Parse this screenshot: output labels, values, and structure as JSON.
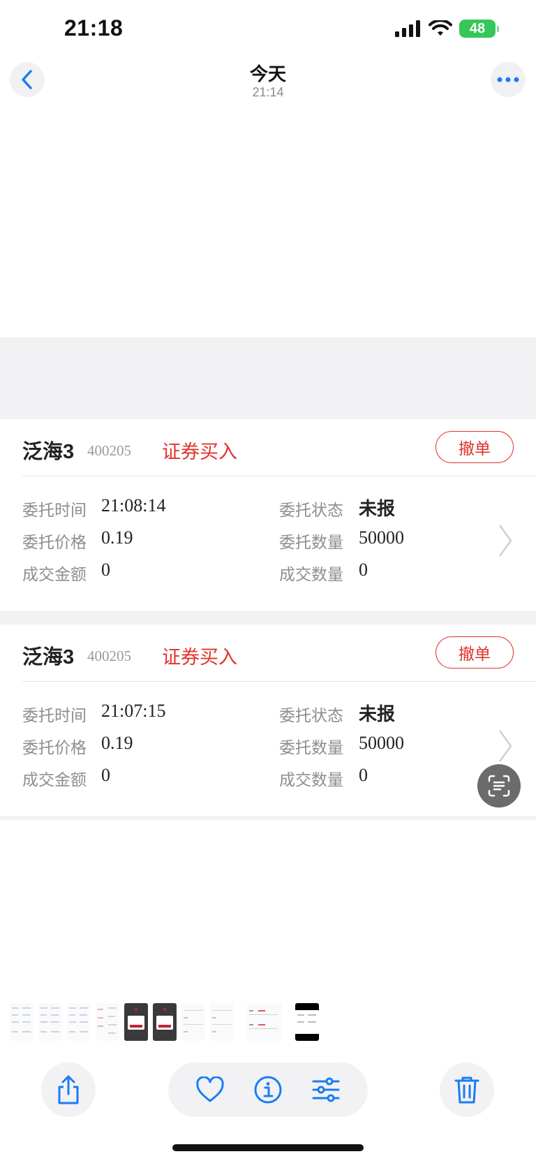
{
  "status_bar": {
    "time": "21:18",
    "battery": "48"
  },
  "nav": {
    "title": "今天",
    "subtitle": "21:14"
  },
  "orders": [
    {
      "name": "泛海3",
      "code": "400205",
      "type": "证券买入",
      "cancel_label": "撤单",
      "fields": [
        {
          "label": "委托时间",
          "value": "21:08:14"
        },
        {
          "label": "委托状态",
          "value": "未报"
        },
        {
          "label": "委托价格",
          "value": "0.19"
        },
        {
          "label": "委托数量",
          "value": "50000"
        },
        {
          "label": "成交金额",
          "value": "0"
        },
        {
          "label": "成交数量",
          "value": "0"
        }
      ]
    },
    {
      "name": "泛海3",
      "code": "400205",
      "type": "证券买入",
      "cancel_label": "撤单",
      "fields": [
        {
          "label": "委托时间",
          "value": "21:07:15"
        },
        {
          "label": "委托状态",
          "value": "未报"
        },
        {
          "label": "委托价格",
          "value": "0.19"
        },
        {
          "label": "委托数量",
          "value": "50000"
        },
        {
          "label": "成交金额",
          "value": "0"
        },
        {
          "label": "成交数量",
          "value": "0"
        }
      ]
    }
  ],
  "toolbar_icons": [
    "share-icon",
    "heart-icon",
    "info-icon",
    "adjust-icon",
    "trash-icon"
  ],
  "colors": {
    "accent_red": "#e0342c",
    "ios_blue": "#1a7cf5",
    "battery_green": "#35c759"
  }
}
